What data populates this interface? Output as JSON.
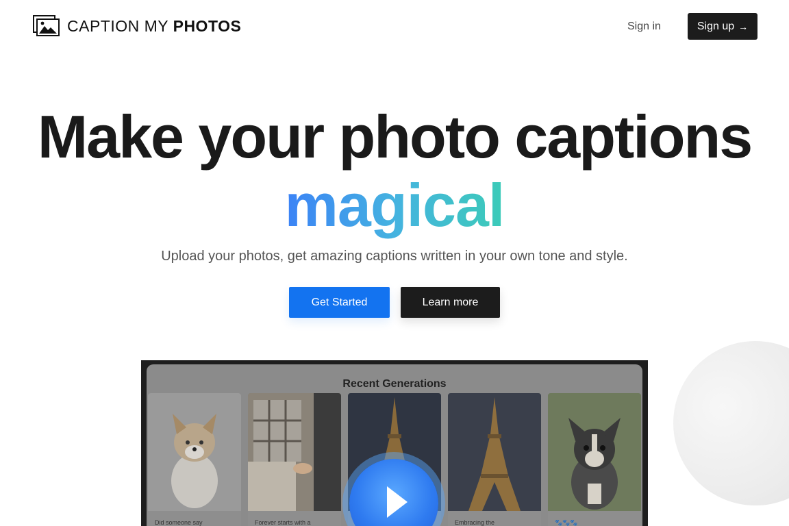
{
  "header": {
    "logo_light": "CAPTION MY",
    "logo_bold": "PHOTOS",
    "signin_label": "Sign in",
    "signup_label": "Sign up",
    "signup_icon": "arrow-right-icon"
  },
  "hero": {
    "title": "Make your photo captions",
    "highlight": "magical",
    "subtitle": "Upload your photos, get amazing captions written in your own tone and style.",
    "primary_button": "Get Started",
    "secondary_button": "Learn more",
    "gradient_colors": [
      "#3b82f6",
      "#45b3e0",
      "#3ccbb8"
    ],
    "primary_color": "#1373f0"
  },
  "video": {
    "panel_title": "Recent Generations",
    "cards": [
      {
        "caption": "Did someone say",
        "subject": "corgi puppy"
      },
      {
        "caption": "Forever starts with a",
        "subject": "couple holding hands"
      },
      {
        "caption": "",
        "subject": "eiffel tower at night"
      },
      {
        "caption": "Embracing the",
        "subject": "eiffel tower at night"
      },
      {
        "caption": "🐾🐾🐾",
        "subject": "boston terrier puppy"
      }
    ],
    "play_icon": "play-icon"
  }
}
